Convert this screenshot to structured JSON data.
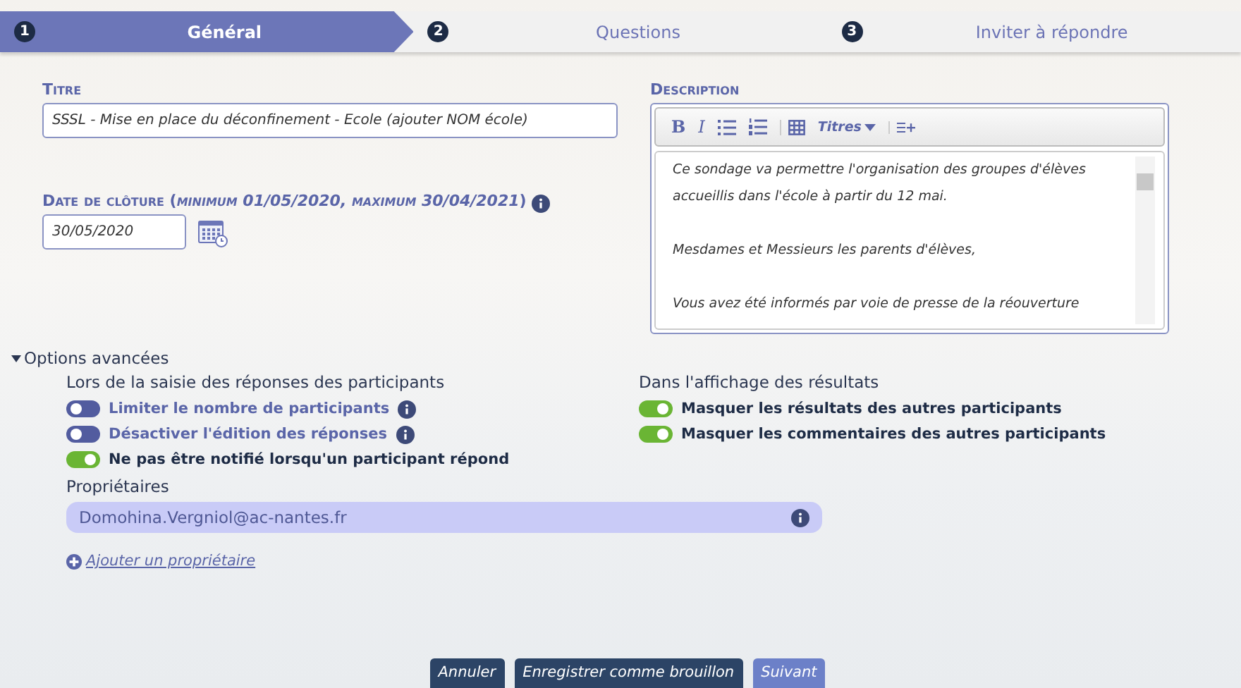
{
  "steps": [
    {
      "number": "1",
      "label": "Général",
      "selected": true
    },
    {
      "number": "2",
      "label": "Questions",
      "selected": false
    },
    {
      "number": "3",
      "label": "Inviter à répondre",
      "selected": false
    }
  ],
  "title_field": {
    "label": "Titre",
    "value": "SSSL - Mise en place du déconfinement - Ecole (ajouter NOM école)"
  },
  "date_field": {
    "label": "Date de clôture",
    "hint": "(*minimum 01/05/2020, maximum 30/04/2021*)",
    "value": "30/05/2020"
  },
  "description": {
    "label": "Description",
    "toolbar": [
      [
        {
          "kind": "bold",
          "label": "B"
        },
        {
          "kind": "italic",
          "label": "I"
        },
        {
          "kind": "bullet-list"
        },
        {
          "kind": "numbered-list"
        }
      ],
      [
        {
          "kind": "table"
        },
        {
          "kind": "dropdown",
          "label": "Titres"
        }
      ],
      [
        {
          "kind": "insert"
        }
      ]
    ],
    "paragraphs": [
      "Ce sondage va permettre l'organisation des groupes d'élèves accueillis dans l'école à partir du 12 mai.",
      "Mesdames et Messieurs les parents d'élèves,",
      "Vous avez été informés par voie de presse de la réouverture"
    ]
  },
  "advanced": {
    "label": "Options avancées",
    "expanded": true,
    "left_heading": "Lors de la saisie des réponses des participants",
    "left_options": [
      {
        "label": "Limiter le nombre de participants",
        "on": false,
        "info": true
      },
      {
        "label": "Désactiver l'édition des réponses",
        "on": false,
        "info": true
      },
      {
        "label": "Ne pas être notifié lorsqu'un participant répond",
        "on": true,
        "info": false
      }
    ],
    "right_heading": "Dans l'affichage des résultats",
    "right_options": [
      {
        "label": "Masquer les résultats des autres participants",
        "on": true,
        "info": false
      },
      {
        "label": "Masquer les commentaires des autres participants",
        "on": true,
        "info": false
      }
    ],
    "owners_heading": "Propriétaires",
    "owners": [
      "Domohina.Vergniol@ac-nantes.fr"
    ],
    "add_owner": "Ajouter un propriétaire"
  },
  "buttons": [
    {
      "label": "Annuler",
      "kind": "secondary"
    },
    {
      "label": "Enregistrer comme brouillon",
      "kind": "secondary"
    },
    {
      "label": "Suivant",
      "kind": "primary"
    }
  ]
}
